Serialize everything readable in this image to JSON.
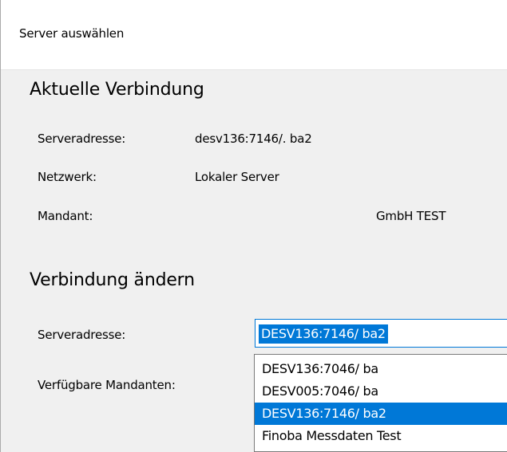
{
  "window": {
    "title": "Server auswählen"
  },
  "current": {
    "heading": "Aktuelle Verbindung",
    "rows": [
      {
        "label": "Serveradresse:",
        "value": "desv136:7146/.      ba2"
      },
      {
        "label": "Netzwerk:",
        "value": "Lokaler Server"
      },
      {
        "label": "Mandant:",
        "value": "GmbH TEST"
      }
    ]
  },
  "change": {
    "heading": "Verbindung ändern",
    "server_label": "Serveradresse:",
    "server_value": "DESV136:7146/          ba2",
    "mandanten_label": "Verfügbare Mandanten:",
    "dropdown_items": [
      {
        "text": "DESV136:7046/          ba",
        "selected": false
      },
      {
        "text": "DESV005:7046/          ba",
        "selected": false
      },
      {
        "text": "DESV136:7146/          ba2",
        "selected": true
      },
      {
        "text": "Finoba Messdaten Test",
        "selected": false
      }
    ]
  },
  "colors": {
    "accent": "#0078d7",
    "dialog_bg": "#f0f0f0",
    "header_bg": "#ffffff"
  }
}
